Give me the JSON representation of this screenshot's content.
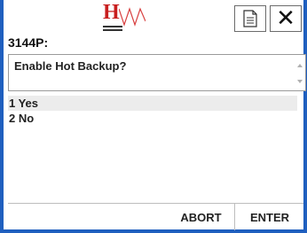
{
  "header": {
    "logo_text": "H",
    "document_icon": "document-icon",
    "close_icon": "close-icon",
    "close_glyph": "✕"
  },
  "screen": {
    "code": "3144P:",
    "prompt": "Enable Hot Backup?"
  },
  "options": [
    {
      "label": "1 Yes",
      "selected": true
    },
    {
      "label": "2 No",
      "selected": false
    }
  ],
  "footer": {
    "abort_label": "ABORT",
    "enter_label": "ENTER"
  },
  "colors": {
    "frame": "#1f5fbf",
    "logo_red": "#c81e1e",
    "selected_row": "#ececec"
  }
}
